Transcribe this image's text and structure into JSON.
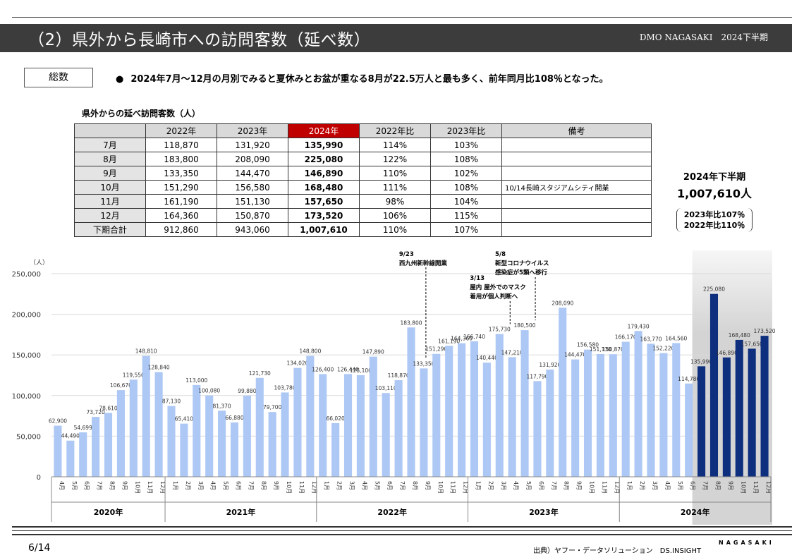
{
  "header": {
    "title": "（2）県外から長崎市への訪問客数（延べ数）",
    "right": "DMO NAGASAKI　2024下半期"
  },
  "badge": "総数",
  "bullet": "2024年7月～12月の月別でみると夏休みとお盆が重なる8月が22.5万人と最も多く、前年同月比108％となった。",
  "table": {
    "title": "県外からの延べ訪問客数（人）",
    "headers": [
      "",
      "2022年",
      "2023年",
      "2024年",
      "2022年比",
      "2023年比",
      "備考"
    ],
    "rows": [
      [
        "7月",
        "118,870",
        "131,920",
        "135,990",
        "114%",
        "103%",
        ""
      ],
      [
        "8月",
        "183,800",
        "208,090",
        "225,080",
        "122%",
        "108%",
        ""
      ],
      [
        "9月",
        "133,350",
        "144,470",
        "146,890",
        "110%",
        "102%",
        ""
      ],
      [
        "10月",
        "151,290",
        "156,580",
        "168,480",
        "111%",
        "108%",
        "10/14長崎スタジアムシティ開業"
      ],
      [
        "11月",
        "161,190",
        "151,130",
        "157,650",
        "98%",
        "104%",
        ""
      ],
      [
        "12月",
        "164,360",
        "150,870",
        "173,520",
        "106%",
        "115%",
        ""
      ],
      [
        "下期合計",
        "912,860",
        "943,060",
        "1,007,610",
        "110%",
        "107%",
        ""
      ]
    ]
  },
  "summary": {
    "title": "2024年下半期",
    "total": "1,007,610人",
    "ratio_2023": "2023年比107％",
    "ratio_2022": "2022年比110％"
  },
  "chart_data": {
    "type": "bar",
    "ylabel": "（人）",
    "ylim": [
      0,
      250000
    ],
    "yticks": [
      "0",
      "50,000",
      "100,000",
      "150,000",
      "200,000",
      "250,000"
    ],
    "yticks_values": [
      0,
      50000,
      100000,
      150000,
      200000,
      250000
    ],
    "grid": true,
    "colors": {
      "normal": "#adc8f5",
      "highlight": "#0e2f7e",
      "highlight_bg": "#d4d4d4"
    },
    "years": [
      {
        "label": "2020年",
        "months": [
          "4月",
          "5月",
          "6月",
          "7月",
          "8月",
          "9月",
          "10月",
          "11月",
          "12月"
        ]
      },
      {
        "label": "2021年",
        "months": [
          "1月",
          "2月",
          "3月",
          "4月",
          "5月",
          "6月",
          "7月",
          "8月",
          "9月",
          "10月",
          "11月",
          "12月"
        ]
      },
      {
        "label": "2022年",
        "months": [
          "1月",
          "2月",
          "3月",
          "4月",
          "5月",
          "6月",
          "7月",
          "8月",
          "9月",
          "10月",
          "11月",
          "12月"
        ]
      },
      {
        "label": "2023年",
        "months": [
          "1月",
          "2月",
          "3月",
          "4月",
          "5月",
          "6月",
          "7月",
          "8月",
          "9月",
          "10月",
          "11月",
          "12月"
        ]
      },
      {
        "label": "2024年",
        "months": [
          "1月",
          "2月",
          "3月",
          "4月",
          "5月",
          "6月",
          "7月",
          "8月",
          "9月",
          "10月",
          "11月",
          "12月"
        ]
      }
    ],
    "values": [
      62900,
      44490,
      54699,
      73720,
      78610,
      106670,
      119550,
      148810,
      128840,
      87130,
      65410,
      113000,
      100080,
      81370,
      66880,
      99880,
      121730,
      79700,
      103780,
      134020,
      148800,
      126400,
      66020,
      126440,
      125100,
      147890,
      103110,
      118870,
      183800,
      133350,
      151290,
      161190,
      164360,
      166740,
      140440,
      175730,
      147210,
      180500,
      117790,
      131920,
      208090,
      144470,
      156580,
      151130,
      150870,
      166170,
      179430,
      163770,
      152220,
      164560,
      114780,
      135990,
      225080,
      146890,
      168480,
      157650,
      173520
    ],
    "value_labels": [
      "62,900",
      "44,490",
      "54,699",
      "73,720",
      "78,610",
      "106,670",
      "119,550",
      "148,810",
      "128,840",
      "87,130",
      "65,410",
      "113,000",
      "100,080",
      "81,370",
      "66,880",
      "99,880",
      "121,730",
      "79,700",
      "103,780",
      "134,020",
      "148,800",
      "126,400",
      "66,020",
      "126,440",
      "125,100",
      "147,890",
      "103,110",
      "118,870",
      "183,800",
      "133,350",
      "151,290",
      "161,190",
      "164,360",
      "166,740",
      "140,440",
      "175,730",
      "147,210",
      "180,500",
      "117,790",
      "131,920",
      "208,090",
      "144,470",
      "156,580",
      "151,130",
      "150,870",
      "166,170",
      "179,430",
      "163,770",
      "152,220",
      "164,560",
      "114,780",
      "135,990",
      "225,080",
      "146,890",
      "168,480",
      "157,650",
      "173,520"
    ],
    "highlight_from_index": 51,
    "annotations": [
      {
        "date": "9/23",
        "text": "西九州新幹線開業",
        "index": 29
      },
      {
        "date": "3/13",
        "text1": "屋内 屋外でのマスク",
        "text2": "着用が個人判断へ",
        "index": 35
      },
      {
        "date": "5/8",
        "text1": "新型コロナウイルス",
        "text2": "感染症が5類へ移行",
        "index": 37
      }
    ]
  },
  "footer": {
    "page": "6/14",
    "source": "出典）ヤフー・データソリューション　DS.INSIGHT",
    "brand": "NAGASAKI"
  }
}
